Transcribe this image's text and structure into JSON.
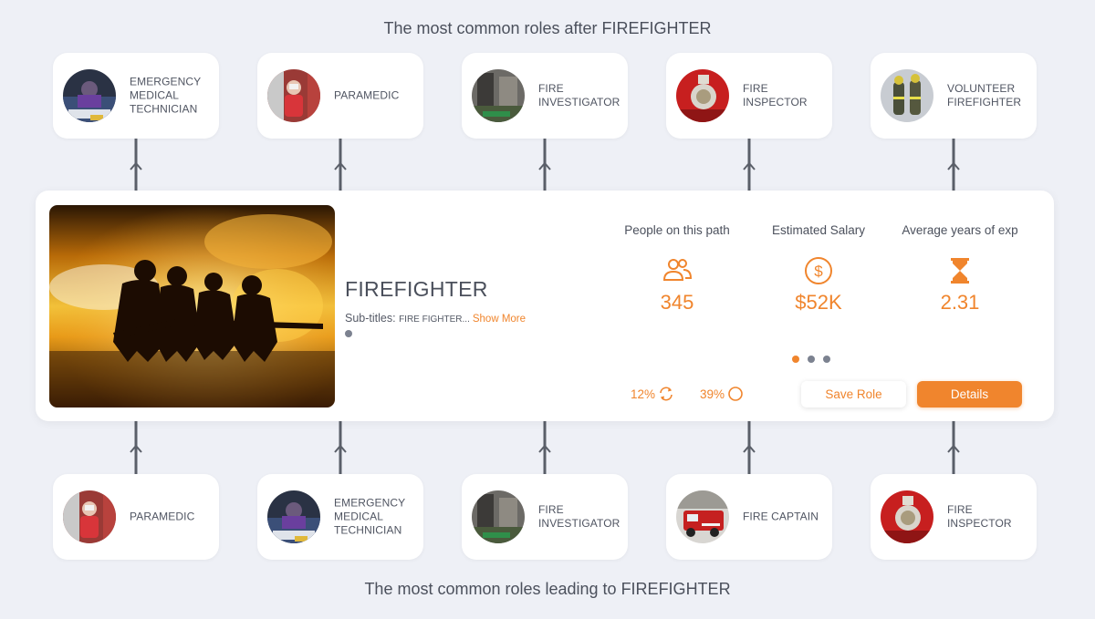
{
  "headings": {
    "top": "The most common roles after FIREFIGHTER",
    "bottom": "The most common roles leading to FIREFIGHTER"
  },
  "next_roles": [
    {
      "label": "EMERGENCY MEDICAL TECHNICIAN"
    },
    {
      "label": "PARAMEDIC"
    },
    {
      "label": "FIRE INVESTIGATOR"
    },
    {
      "label": "FIRE INSPECTOR"
    },
    {
      "label": "VOLUNTEER FIREFIGHTER"
    }
  ],
  "previous_roles": [
    {
      "label": "PARAMEDIC"
    },
    {
      "label": "EMERGENCY MEDICAL TECHNICIAN"
    },
    {
      "label": "FIRE INVESTIGATOR"
    },
    {
      "label": "FIRE CAPTAIN"
    },
    {
      "label": "FIRE INSPECTOR"
    }
  ],
  "role": {
    "title": "FIREFIGHTER",
    "subtitles_label": "Sub-titles:",
    "subtitles_value": "FIRE FIGHTER...",
    "show_more": "Show More"
  },
  "stats": [
    {
      "label": "People on this path",
      "value": "345",
      "icon": "people-icon"
    },
    {
      "label": "Estimated Salary",
      "value": "$52K",
      "icon": "dollar-icon"
    },
    {
      "label": "Average years of exp",
      "value": "2.31",
      "icon": "hourglass-icon"
    }
  ],
  "carousel": {
    "count": 3,
    "active_index": 0
  },
  "metrics": {
    "first": "12%",
    "first_icon": "refresh-icon",
    "second": "39%",
    "second_icon": "circle-icon"
  },
  "buttons": {
    "save": "Save Role",
    "details": "Details"
  },
  "colors": {
    "accent": "#f0852d",
    "background": "#eef0f6",
    "connector": "#5a5f69",
    "inactive_dot": "#7c8290"
  }
}
